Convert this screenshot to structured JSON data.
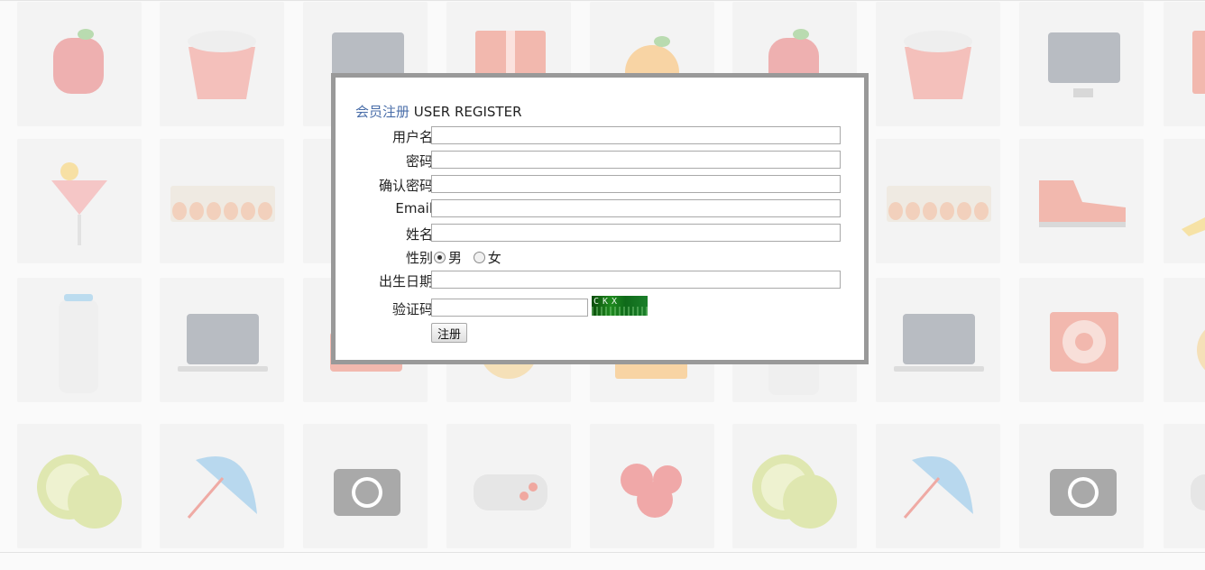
{
  "form": {
    "title_cn": "会员注册",
    "title_en": "USER REGISTER",
    "fields": [
      {
        "label": "用户名",
        "value": ""
      },
      {
        "label": "密码",
        "value": ""
      },
      {
        "label": "确认密码",
        "value": ""
      },
      {
        "label": "Email",
        "value": ""
      },
      {
        "label": "姓名",
        "value": ""
      }
    ],
    "gender": {
      "label": "性别",
      "options": [
        "男",
        "女"
      ],
      "selected": "男"
    },
    "birthdate": {
      "label": "出生日期",
      "value": ""
    },
    "captcha": {
      "label": "验证码",
      "value": "",
      "image_text": "CKX"
    },
    "submit_label": "注册"
  },
  "colors": {
    "dialog_border": "#999999",
    "title_link": "#4a6ea9",
    "captcha_bg": "#1f8a1f"
  },
  "background_icons": [
    [
      "apple-icon",
      "popcorn-icon",
      "monitor-icon",
      "gift-icon",
      "orange-icon",
      "apple-icon",
      "popcorn-icon",
      "monitor-icon",
      "gift-icon"
    ],
    [
      "cocktail-icon",
      "eggs-icon",
      "monitor-icon",
      "eggs-icon",
      "eggs-icon",
      "eggs-icon",
      "eggs-icon",
      "sneaker-icon",
      "pencil-icon"
    ],
    [
      "milk-bottle-icon",
      "laptop-icon",
      "radio-icon",
      "ball-icon",
      "juice-icon",
      "phone-icon",
      "laptop-icon",
      "ipod-icon",
      "ball-icon"
    ],
    [
      "kiwi-icon",
      "umbrella-icon",
      "camera-icon",
      "gamepad-icon",
      "cherry-icon",
      "kiwi-icon",
      "umbrella-icon",
      "camera-icon",
      "gamepad-icon"
    ]
  ]
}
